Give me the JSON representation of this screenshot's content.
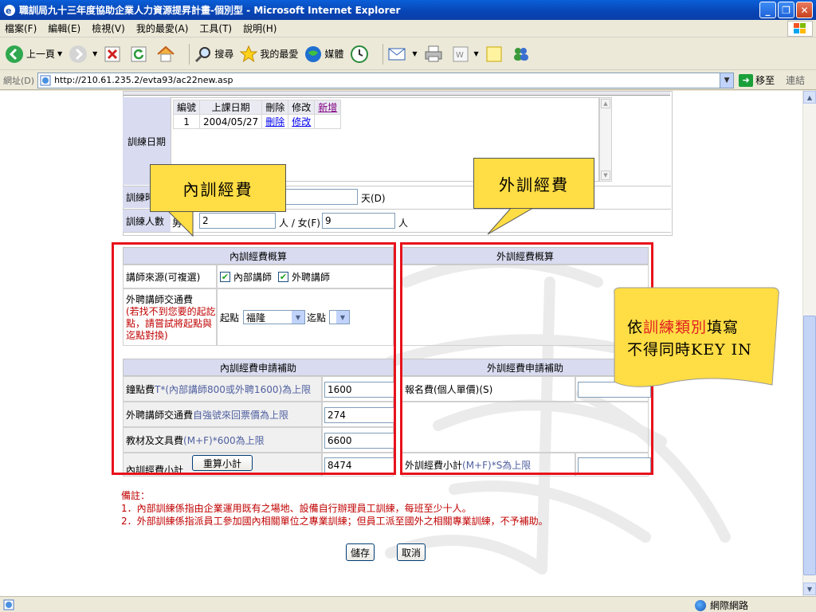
{
  "window": {
    "title": "職訓局九十三年度協助企業人力資源提昇計畫-個別型 - Microsoft Internet Explorer"
  },
  "menu": [
    "檔案(F)",
    "編輯(E)",
    "檢視(V)",
    "我的最愛(A)",
    "工具(T)",
    "說明(H)"
  ],
  "toolbar": {
    "back": "上一頁",
    "search": "搜尋",
    "favorites": "我的最愛",
    "media": "媒體"
  },
  "address": {
    "label": "網址(D)",
    "url": "http://210.61.235.2/evta93/ac22new.asp",
    "go": "移至",
    "links": "連結"
  },
  "status": {
    "zone": "網際網路"
  },
  "form": {
    "train_date_label": "訓練日期",
    "date_table": {
      "headers": [
        "編號",
        "上課日期",
        "刪除",
        "修改",
        "新增"
      ],
      "rows": [
        [
          "1",
          "2004/05/27",
          "刪除",
          "修改",
          ""
        ]
      ]
    },
    "hours_label": "訓練時",
    "hours_value": "",
    "hours_unit": "天(D)",
    "count_label": "訓練人數",
    "male_label": "男",
    "male_value": "2",
    "female_label": "人 / 女(F)",
    "female_value": "9",
    "person_unit": "人"
  },
  "internal": {
    "summary_header": "內訓經費概算",
    "source_label": "講師來源(可複選)",
    "source_internal": "內部講師",
    "source_external": "外聘講師",
    "travel_label": "外聘講師交通費",
    "travel_note": "(若找不到您要的起訖點，請嘗試將起點與迄點對換)",
    "start_label": "起點",
    "start_value": "福隆",
    "end_label": "迄點",
    "end_value": "",
    "subsidy_header": "內訓經費申請補助",
    "hour_fee_label": "鐘點費",
    "hour_fee_note": "T*(內部講師800或外聘1600)為上限",
    "hour_fee_value": "1600",
    "travel_fee_label": "外聘講師交通費",
    "travel_fee_note": "自強號來回票價為上限",
    "travel_fee_value": "274",
    "material_label": "教材及文具費",
    "material_note": "(M+F)*600為上限",
    "material_value": "6600",
    "subtotal_label": "內訓經費小計",
    "recalc_button": "重算小計",
    "subtotal_value": "8474"
  },
  "external": {
    "summary_header": "外訓經費概算",
    "subsidy_header": "外訓經費申請補助",
    "fee_label": "報名費(個人單價)(S)",
    "fee_value": "",
    "subtotal_label": "外訓經費小計",
    "subtotal_note": "(M+F)*S為上限",
    "subtotal_value": ""
  },
  "remarks": {
    "title": "備註：",
    "line1": "1．內部訓練係指由企業運用既有之場地、設備自行辦理員工訓練，每班至少十人。",
    "line2": "2．外部訓練係指派員工參加國內相關單位之專業訓練；但員工派至國外之相關專業訓練，不予補助。"
  },
  "actions": {
    "save": "儲存",
    "cancel": "取消"
  },
  "callouts": {
    "internal": "內訓經費",
    "external": "外訓經費",
    "note_prefix": "依",
    "note_red": "訓練類別",
    "note_suffix": "填寫",
    "note_line2": "不得同時KEY IN"
  },
  "colors": {
    "highlight_frame": "#e8121b",
    "callout_fill": "#ffdd44",
    "section_header": "#d9dcf0",
    "note_text_red": "#c00000"
  }
}
